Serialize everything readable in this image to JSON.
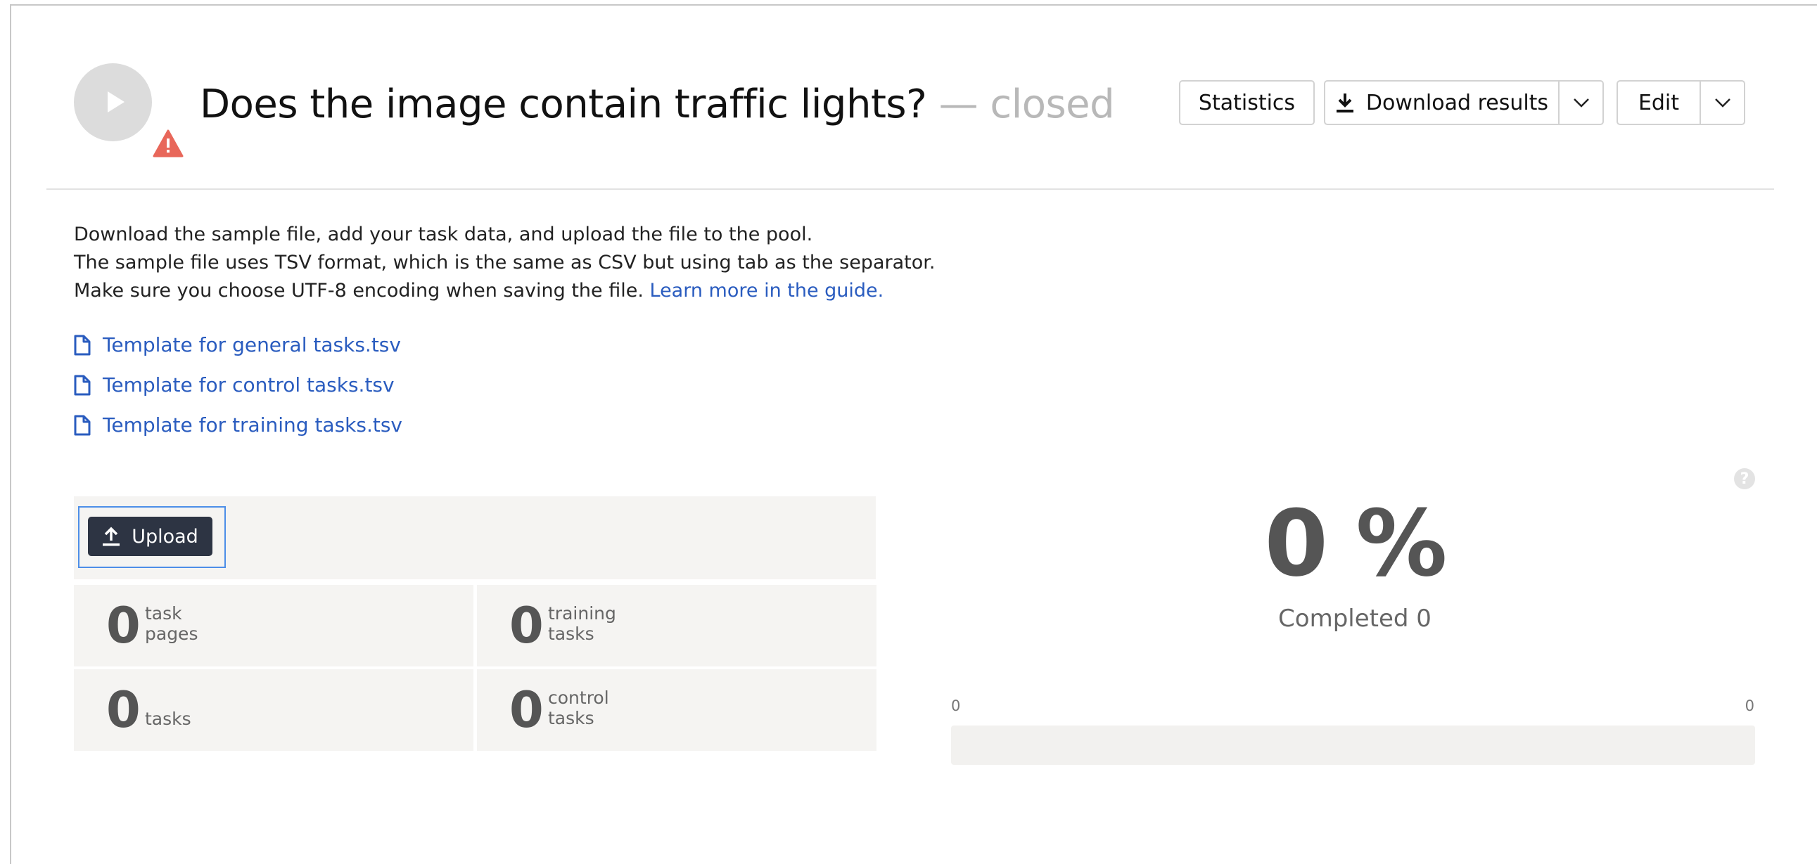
{
  "header": {
    "title": "Does the image contain traffic lights?",
    "status": " — closed",
    "buttons": {
      "statistics": "Statistics",
      "download_results": "Download results",
      "edit": "Edit"
    },
    "icons": {
      "play": "play-icon",
      "warning": "warning-icon",
      "download": "download-icon",
      "dropdown": "chevron-down-icon"
    }
  },
  "instructions": {
    "line1": "Download the sample file, add your task data, and upload the file to the pool.",
    "line2": "The sample file uses TSV format, which is the same as CSV but using tab as the separator.",
    "line3": "Make sure you choose UTF-8 encoding when saving the file. ",
    "guide_link": "Learn more in the guide."
  },
  "templates": [
    {
      "label": "Template for general tasks.tsv",
      "icon": "file-icon"
    },
    {
      "label": "Template for control tasks.tsv",
      "icon": "file-icon"
    },
    {
      "label": "Template for training tasks.tsv",
      "icon": "file-icon"
    }
  ],
  "upload": {
    "label": "Upload",
    "icon": "upload-icon"
  },
  "stats": {
    "task_pages": {
      "value": "0",
      "line1": "task",
      "line2": "pages"
    },
    "training_tasks": {
      "value": "0",
      "line1": "training",
      "line2": "tasks"
    },
    "tasks": {
      "value": "0",
      "label": "tasks"
    },
    "control_tasks": {
      "value": "0",
      "line1": "control",
      "line2": "tasks"
    }
  },
  "progress": {
    "percent_text": "0 %",
    "percent_value": 0,
    "completed_text": "Completed 0",
    "range_min": "0",
    "range_max": "0",
    "help_icon": "help-icon"
  },
  "colors": {
    "link": "#2a5cbf",
    "upload_button": "#2d3443",
    "warning": "#e8675a",
    "focus": "#4d8ee8"
  }
}
